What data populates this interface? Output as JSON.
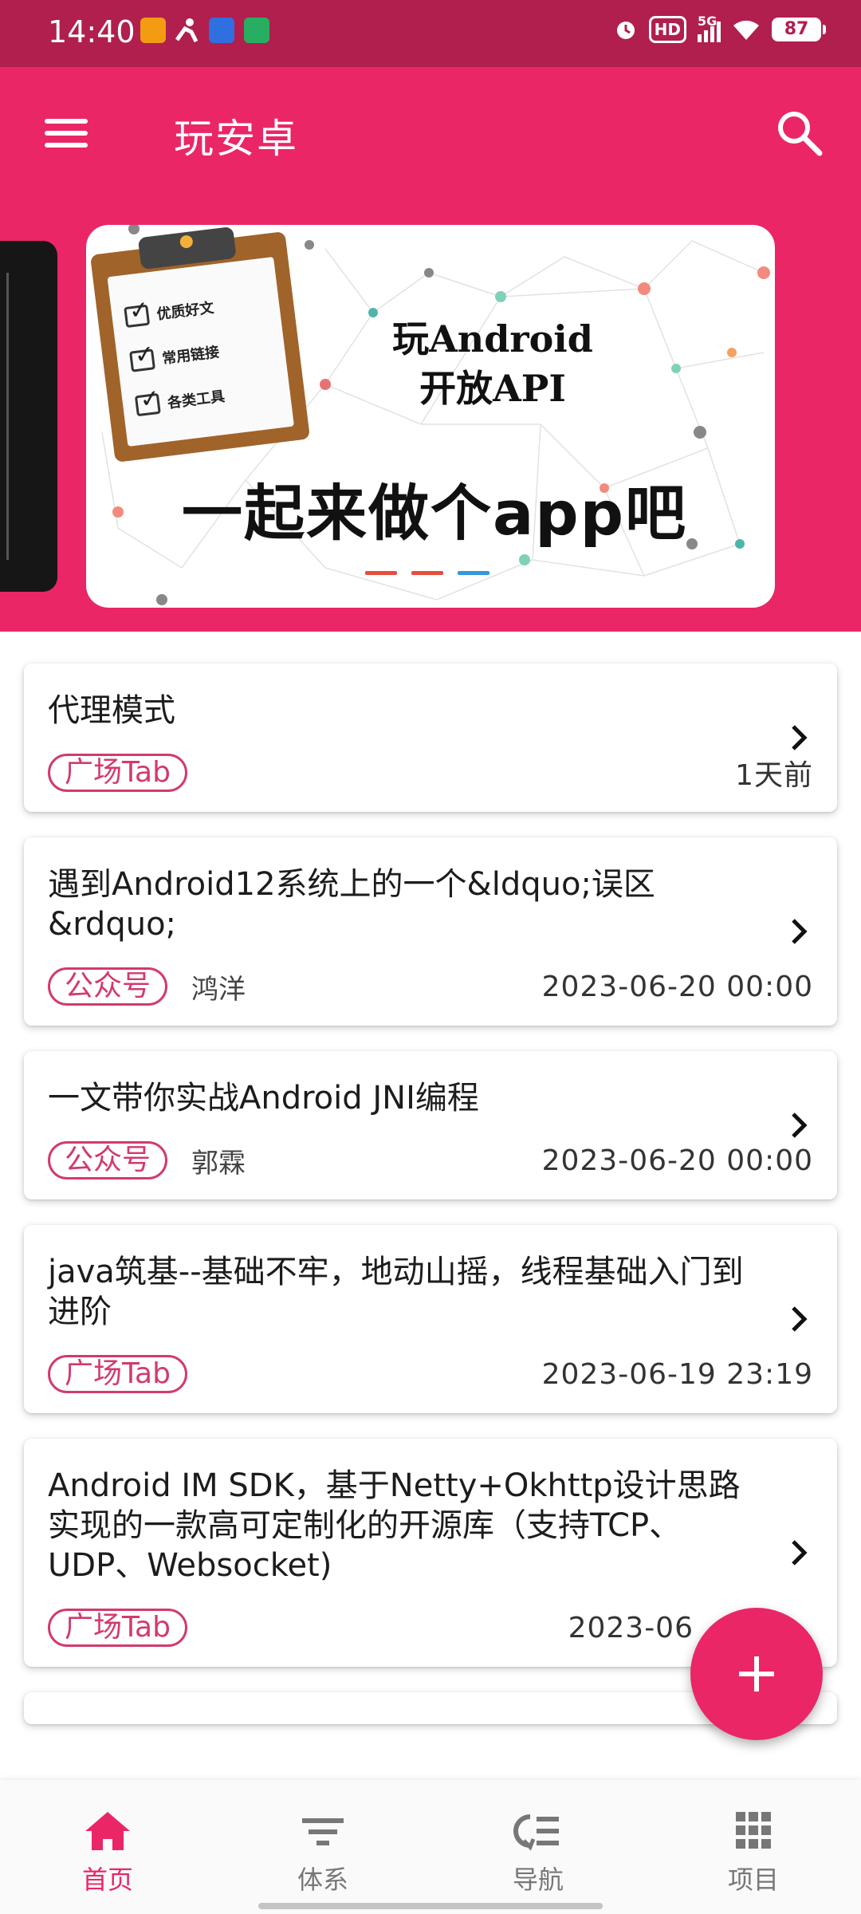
{
  "status_bar": {
    "time": "14:40",
    "hd": "HD",
    "network": "5G",
    "battery": "87"
  },
  "app_bar": {
    "title": "玩安卓"
  },
  "banner": {
    "clipboard_items": [
      "优质好文",
      "常用链接",
      "各类工具"
    ],
    "heading_line1": "玩Android",
    "heading_line2": "开放API",
    "slogan": "一起来做个app吧"
  },
  "articles": [
    {
      "title": "代理模式",
      "tag": "广场Tab",
      "author": "",
      "date": "1天前"
    },
    {
      "title": "遇到Android12系统上的一个&ldquo;误区&rdquo;",
      "tag": "公众号",
      "author": "鸿洋",
      "date": "2023-06-20 00:00"
    },
    {
      "title": "一文带你实战Android JNI编程",
      "tag": "公众号",
      "author": "郭霖",
      "date": "2023-06-20 00:00"
    },
    {
      "title": "java筑基--基础不牢，地动山摇，线程基础入门到进阶",
      "tag": "广场Tab",
      "author": "",
      "date": "2023-06-19 23:19"
    },
    {
      "title": "Android IM SDK，基于Netty+Okhttp设计思路实现的一款高可定制化的开源库（支持TCP、UDP、Websocket)",
      "tag": "广场Tab",
      "author": "",
      "date": "2023-06"
    }
  ],
  "bottom_nav": {
    "items": [
      {
        "label": "首页",
        "icon": "home-icon",
        "active": true
      },
      {
        "label": "体系",
        "icon": "filter-icon",
        "active": false
      },
      {
        "label": "导航",
        "icon": "navigation-list-icon",
        "active": false
      },
      {
        "label": "项目",
        "icon": "grid-icon",
        "active": false
      }
    ]
  },
  "colors": {
    "primary": "#ea2667",
    "status_bar": "#b01f4e",
    "tag": "#d23a6e"
  }
}
